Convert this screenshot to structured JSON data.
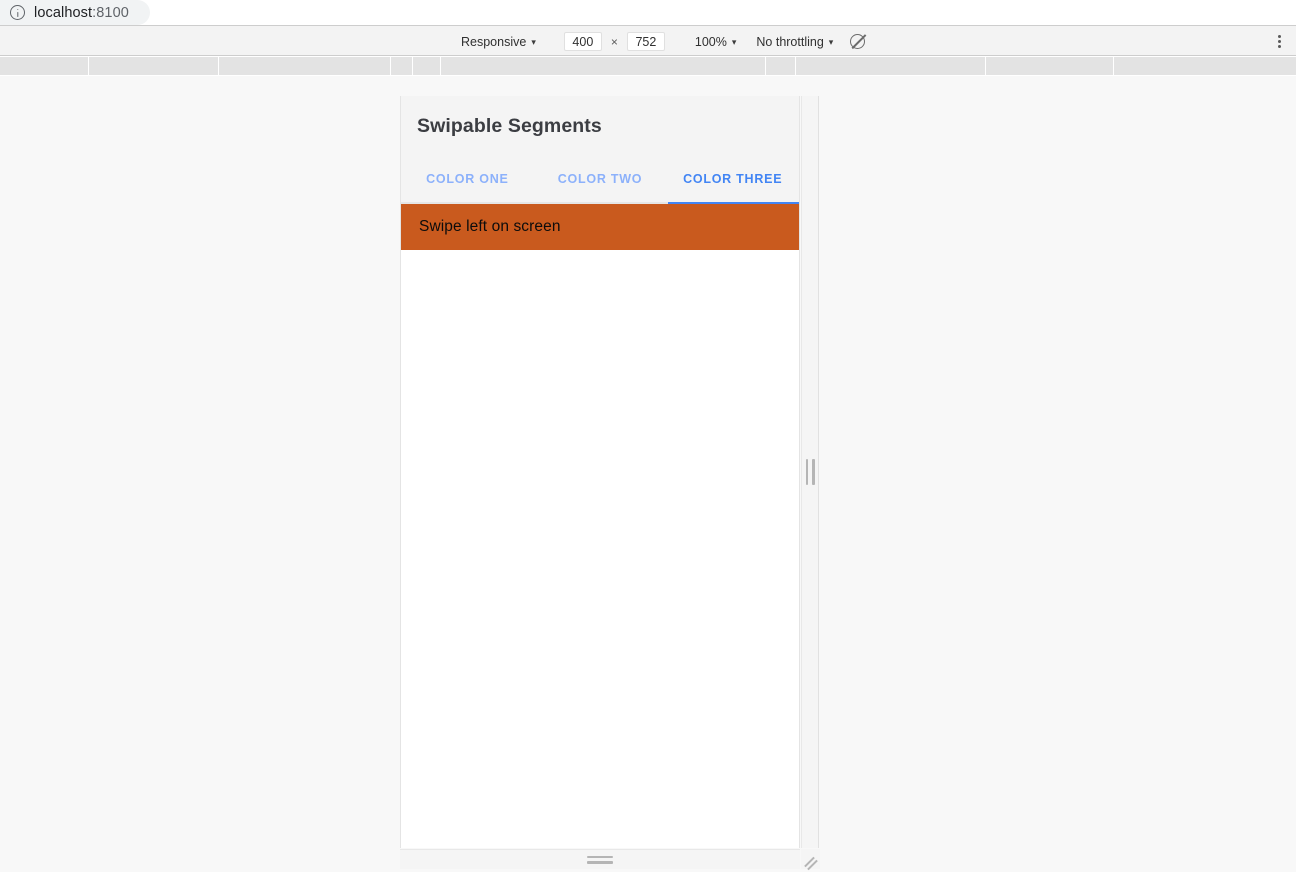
{
  "browser": {
    "url_host": "localhost",
    "url_port": ":8100",
    "info_icon": "info-circle-icon"
  },
  "device_toolbar": {
    "device_preset": "Responsive",
    "width": "400",
    "times": "×",
    "height": "752",
    "zoom": "100%",
    "throttling": "No throttling",
    "screenshot_icon": "no-screenshot-slashed-circle-icon",
    "more_icon": "three-dot-vertical-menu-icon",
    "caret": "▾"
  },
  "ruler": {
    "ticks": [
      88,
      218,
      390,
      412,
      440,
      765,
      795,
      985,
      1113
    ]
  },
  "app": {
    "title": "Swipable Segments",
    "tabs": [
      {
        "label": "COLOR ONE",
        "active": false
      },
      {
        "label": "COLOR TWO",
        "active": false
      },
      {
        "label": "COLOR THREE",
        "active": true
      }
    ],
    "banner": {
      "text": "Swipe left on screen",
      "color": "#c95a1e"
    },
    "accent_color": "#4285f4",
    "inactive_tab_color": "#8cb1fb"
  },
  "handles": {
    "right": "vertical-resize-handle",
    "bottom": "horizontal-resize-handle",
    "corner": "corner-resize-grip"
  }
}
